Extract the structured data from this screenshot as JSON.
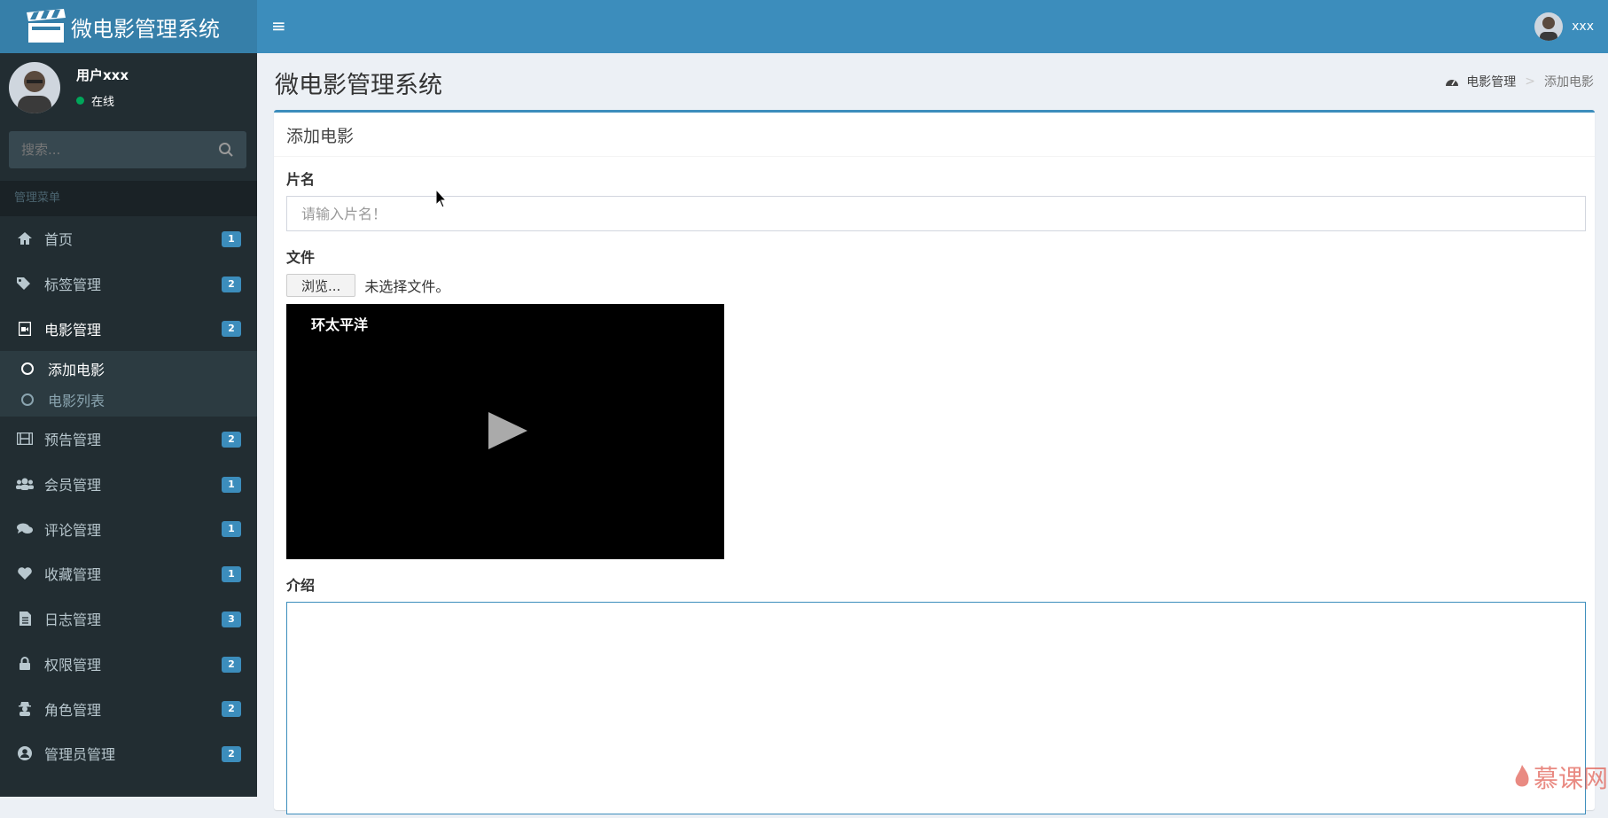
{
  "brand": {
    "title": "微电影管理系统"
  },
  "topbar": {
    "menu_toggle": "≡",
    "username": "xxx"
  },
  "user_panel": {
    "name": "用户xxx",
    "status": "在线"
  },
  "search": {
    "placeholder": "搜索..."
  },
  "sidebar": {
    "header": "管理菜单",
    "items": [
      {
        "label": "首页",
        "icon": "home-icon",
        "badge": "1"
      },
      {
        "label": "标签管理",
        "icon": "tags-icon",
        "badge": "2"
      },
      {
        "label": "电影管理",
        "icon": "file-video-icon",
        "badge": "2"
      },
      {
        "label": "预告管理",
        "icon": "film-icon",
        "badge": "2"
      },
      {
        "label": "会员管理",
        "icon": "users-icon",
        "badge": "1"
      },
      {
        "label": "评论管理",
        "icon": "comments-icon",
        "badge": "1"
      },
      {
        "label": "收藏管理",
        "icon": "heart-icon",
        "badge": "1"
      },
      {
        "label": "日志管理",
        "icon": "file-text-icon",
        "badge": "3"
      },
      {
        "label": "权限管理",
        "icon": "lock-icon",
        "badge": "2"
      },
      {
        "label": "角色管理",
        "icon": "user-secret-icon",
        "badge": "2"
      },
      {
        "label": "管理员管理",
        "icon": "user-circle-icon",
        "badge": "2"
      }
    ],
    "submenu": [
      {
        "label": "添加电影"
      },
      {
        "label": "电影列表"
      }
    ]
  },
  "page": {
    "title": "微电影管理系统",
    "breadcrumb": [
      "电影管理",
      "添加电影"
    ]
  },
  "box": {
    "title": "添加电影"
  },
  "form": {
    "name_label": "片名",
    "name_placeholder": "请输入片名！",
    "file_label": "文件",
    "file_button": "浏览...",
    "file_status": "未选择文件。",
    "video_title": "环太平洋",
    "intro_label": "介绍"
  },
  "watermark": {
    "text": "慕课网"
  },
  "colors": {
    "header": "#3c8dbc",
    "logo": "#367fa9",
    "sidebar": "#222d32",
    "badge": "#3c8dbc"
  }
}
